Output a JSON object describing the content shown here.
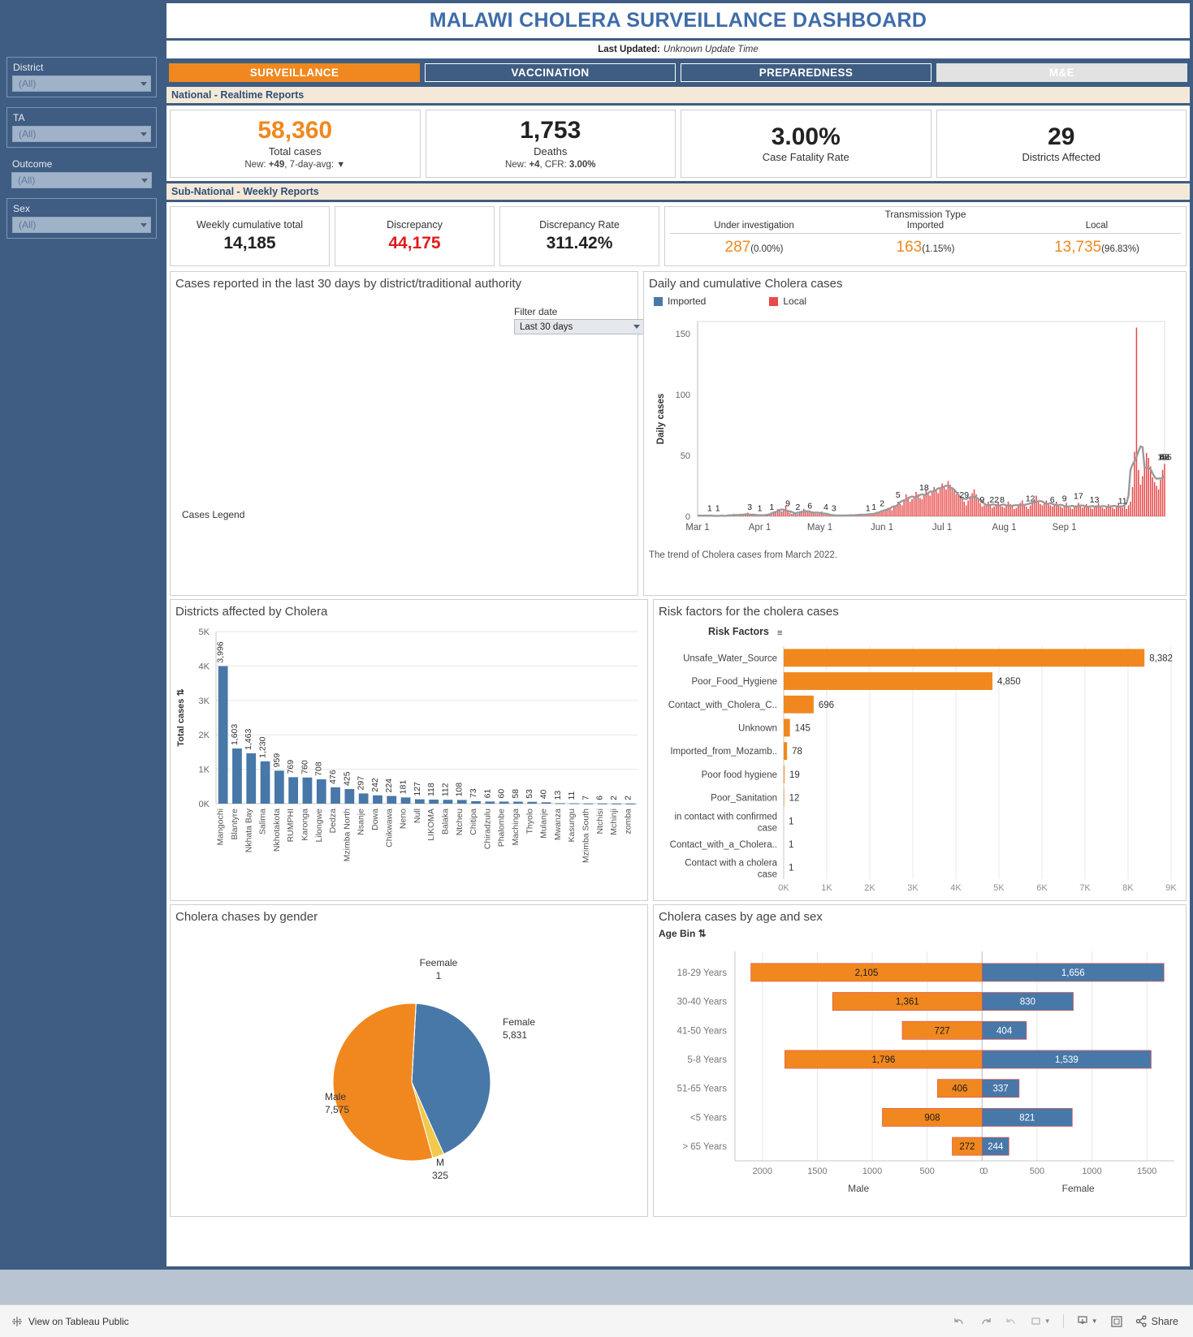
{
  "header": {
    "title": "MALAWI CHOLERA SURVEILLANCE DASHBOARD",
    "last_updated_label": "Last Updated:",
    "last_updated_value": "Unknown Update Time",
    "tabs": [
      {
        "label": "SURVEILLANCE",
        "state": "active"
      },
      {
        "label": "VACCINATION",
        "state": "normal"
      },
      {
        "label": "PREPAREDNESS",
        "state": "normal"
      },
      {
        "label": "M&E",
        "state": "inactive"
      }
    ]
  },
  "sidebar": {
    "filters": [
      {
        "label": "District",
        "value": "(All)"
      },
      {
        "label": "TA",
        "value": "(All)"
      },
      {
        "label": "Outcome",
        "value": "(All)"
      },
      {
        "label": "Sex",
        "value": "(All)"
      }
    ]
  },
  "national": {
    "section_label": "National - Realtime Reports",
    "kpis": [
      {
        "value": "58,360",
        "label": "Total cases",
        "sub_prefix": "New: ",
        "sub_new": "+49",
        "sub_mid": ", 7-day-avg: ",
        "trend": "▼",
        "color": "#f0881f"
      },
      {
        "value": "1,753",
        "label": "Deaths",
        "sub_prefix": "New: ",
        "sub_new": "+4",
        "sub_mid": ", CFR: ",
        "trend": "3.00%",
        "color": "#222222"
      },
      {
        "value": "3.00%",
        "label": "Case Fatality Rate",
        "color": "#222222"
      },
      {
        "value": "29",
        "label": "Districts Affected",
        "color": "#222222"
      }
    ]
  },
  "subnational": {
    "section_label": "Sub-National - Weekly Reports",
    "cards": [
      {
        "title": "Weekly cumulative total",
        "value": "14,185",
        "color": "#222222"
      },
      {
        "title": "Discrepancy",
        "value": "44,175",
        "color": "#e01b1b"
      },
      {
        "title": "Discrepancy Rate",
        "value": "311.42%",
        "color": "#222222"
      }
    ],
    "transmission": {
      "title": "Transmission Type",
      "columns": [
        "Under investigation",
        "Imported",
        "Local"
      ],
      "values": [
        "287",
        "163",
        "13,735"
      ],
      "percents": [
        "(0.00%)",
        "(1.15%)",
        "(96.83%)"
      ]
    }
  },
  "map_panel": {
    "title": "Cases reported in the last 30 days by district/traditional authority",
    "filter_label": "Filter date",
    "filter_value": "Last 30 days",
    "legend_label": "Cases Legend"
  },
  "timeseries_panel": {
    "title": "Daily and cumulative Cholera cases",
    "caption": "The trend of Cholera cases from March 2022."
  },
  "districts_panel": {
    "title": "Districts affected by Cholera"
  },
  "risk_panel": {
    "title": "Risk factors for the cholera cases",
    "field_label": "Risk Factors"
  },
  "gender_panel": {
    "title": "Cholera chases by gender"
  },
  "agesex_panel": {
    "title": "Cholera cases by age and sex",
    "field_label": "Age Bin"
  },
  "footer": {
    "view_label": "View on Tableau Public",
    "share_label": "Share",
    "icons": [
      "undo-icon",
      "redo-icon",
      "revert-icon",
      "refresh-icon",
      "pause-dropdown-icon",
      "download-icon",
      "fullscreen-icon",
      "share-icon"
    ]
  },
  "chart_data": [
    {
      "type": "bar",
      "name": "daily-cumulative-cholera-cases",
      "title": "Daily and cumulative Cholera cases",
      "xlabel": "",
      "ylabel": "Daily cases",
      "ylim": [
        0,
        160
      ],
      "yticks": [
        0,
        50,
        100,
        150
      ],
      "xticks": [
        "Mar 1",
        "Apr 1",
        "May 1",
        "Jun 1",
        "Jul 1",
        "Aug 1",
        "Sep 1"
      ],
      "legend": [
        {
          "name": "Imported",
          "color": "#4878a8"
        },
        {
          "name": "Local",
          "color": "#e8494a"
        }
      ],
      "legend_position": "top-left",
      "grid": false,
      "annotations": [
        {
          "label": "1",
          "x": 6
        },
        {
          "label": "1",
          "x": 10
        },
        {
          "label": "3",
          "x": 26
        },
        {
          "label": "1",
          "x": 31
        },
        {
          "label": "1",
          "x": 37
        },
        {
          "label": "9",
          "x": 45
        },
        {
          "label": "2",
          "x": 50
        },
        {
          "label": "6",
          "x": 56
        },
        {
          "label": "4",
          "x": 64
        },
        {
          "label": "3",
          "x": 68
        },
        {
          "label": "1",
          "x": 85
        },
        {
          "label": "1",
          "x": 88
        },
        {
          "label": "2",
          "x": 92
        },
        {
          "label": "5",
          "x": 100
        },
        {
          "label": "18",
          "x": 113
        },
        {
          "label": "29",
          "x": 133
        },
        {
          "label": "9",
          "x": 142
        },
        {
          "label": "22",
          "x": 148
        },
        {
          "label": "8",
          "x": 152
        },
        {
          "label": "12",
          "x": 166
        },
        {
          "label": "6",
          "x": 177
        },
        {
          "label": "9",
          "x": 183
        },
        {
          "label": "17",
          "x": 190
        },
        {
          "label": "13",
          "x": 198
        },
        {
          "label": "11",
          "x": 212
        },
        {
          "label": "155",
          "x": 233
        },
        {
          "label": "52",
          "x": 243
        },
        {
          "label": "48",
          "x": 245
        },
        {
          "label": "43",
          "x": 253
        }
      ],
      "series": [
        {
          "name": "Local",
          "color": "#e8494a",
          "peak": 155,
          "note": "daily local cases, March 2022 - Sep 2022"
        },
        {
          "name": "Imported",
          "color": "#4878a8",
          "peak": 9,
          "note": "daily imported cases"
        }
      ],
      "rolling_average_line": {
        "name": "7-day average",
        "color": "#999999"
      },
      "values": [
        0,
        1,
        0,
        1,
        1,
        0,
        1,
        0,
        0,
        1,
        1,
        0,
        0,
        0,
        1,
        1,
        0,
        1,
        2,
        1,
        0,
        1,
        2,
        1,
        1,
        3,
        2,
        1,
        1,
        1,
        1,
        1,
        1,
        0,
        1,
        1,
        1,
        2,
        3,
        4,
        6,
        5,
        4,
        6,
        9,
        5,
        3,
        2,
        2,
        2,
        2,
        3,
        4,
        6,
        5,
        4,
        3,
        4,
        3,
        2,
        2,
        3,
        4,
        3,
        2,
        1,
        1,
        1,
        1,
        0,
        1,
        1,
        0,
        1,
        1,
        0,
        1,
        1,
        1,
        1,
        1,
        1,
        1,
        2,
        2,
        1,
        1,
        2,
        2,
        2,
        3,
        3,
        5,
        4,
        6,
        7,
        6,
        5,
        8,
        9,
        12,
        10,
        9,
        14,
        18,
        16,
        12,
        14,
        16,
        20,
        18,
        15,
        14,
        18,
        22,
        19,
        17,
        20,
        24,
        22,
        19,
        23,
        27,
        25,
        22,
        29,
        26,
        24,
        21,
        18,
        20,
        16,
        14,
        12,
        9,
        13,
        16,
        19,
        22,
        18,
        14,
        11,
        8,
        9,
        10,
        12,
        9,
        7,
        8,
        10,
        12,
        9,
        8,
        7,
        9,
        12,
        10,
        8,
        6,
        7,
        9,
        11,
        13,
        10,
        8,
        6,
        9,
        11,
        14,
        17,
        13,
        10,
        9,
        12,
        13,
        11,
        9,
        8,
        10,
        12,
        9,
        8,
        7,
        9,
        11,
        8,
        7,
        6,
        8,
        9,
        11,
        8,
        7,
        9,
        10,
        8,
        7,
        6,
        8,
        9,
        11,
        8,
        7,
        6,
        8,
        10,
        9,
        7,
        6,
        8,
        11,
        9,
        7,
        8,
        6,
        9,
        12,
        24,
        53,
        155,
        38,
        26,
        33,
        45,
        52,
        48,
        41,
        32,
        28,
        25,
        22,
        30,
        38,
        43
      ]
    },
    {
      "type": "bar",
      "name": "districts-affected-by-cholera",
      "title": "Districts affected by Cholera",
      "xlabel": "",
      "ylabel": "Total cases",
      "ylim": [
        0,
        5000
      ],
      "yticks": [
        "0K",
        "1K",
        "2K",
        "3K",
        "4K",
        "5K"
      ],
      "bar_color": "#4878a8",
      "categories": [
        "Mangochi",
        "Blantyre",
        "Nkhata Bay",
        "Salima",
        "Nkhotakota",
        "RUMPHI",
        "Karonga",
        "Lilongwe",
        "Dedza",
        "Mzimba North",
        "Nsanje",
        "Dowa",
        "Chikwawa",
        "Neno",
        "Null",
        "LIKOMA",
        "Balaka",
        "Ntcheu",
        "Chitipa",
        "Chiradzulu",
        "Phalombe",
        "Machinga",
        "Thyolo",
        "Mulanje",
        "Mwanza",
        "Kasungu",
        "Mzimba South",
        "Ntchisi",
        "Mchinji",
        "zomba"
      ],
      "values": [
        3996,
        1603,
        1463,
        1230,
        959,
        769,
        760,
        708,
        476,
        425,
        297,
        242,
        224,
        181,
        127,
        118,
        112,
        108,
        73,
        61,
        60,
        58,
        53,
        40,
        13,
        11,
        7,
        6,
        2,
        2
      ],
      "value_labels": [
        "3,996",
        "1,603",
        "1,463",
        "1,230",
        "959",
        "769",
        "760",
        "708",
        "476",
        "425",
        "297",
        "242",
        "224",
        "181",
        "127",
        "118",
        "112",
        "108",
        "73",
        "61",
        "60",
        "58",
        "53",
        "40",
        "13",
        "11",
        "7",
        "6",
        "2",
        "2"
      ]
    },
    {
      "type": "bar",
      "name": "risk-factors-for-cholera-cases",
      "title": "Risk factors for the cholera cases",
      "orientation": "horizontal",
      "xlabel": "",
      "ylabel": "Risk Factors",
      "bar_color": "#f0881f",
      "xlim": [
        0,
        9000
      ],
      "xticks": [
        "0K",
        "1K",
        "2K",
        "3K",
        "4K",
        "5K",
        "6K",
        "7K",
        "8K",
        "9K"
      ],
      "categories": [
        "Unsafe_Water_Source",
        "Poor_Food_Hygiene",
        "Contact_with_Cholera_C..",
        "Unknown",
        "Imported_from_Mozamb..",
        "Poor food hygiene",
        "Poor_Sanitation",
        "in contact with confirmed case",
        "Contact_with_a_Cholera..",
        "Contact with a cholera case"
      ],
      "values": [
        8382,
        4850,
        696,
        145,
        78,
        19,
        12,
        1,
        1,
        1
      ],
      "value_labels": [
        "8,382",
        "4,850",
        "696",
        "145",
        "78",
        "19",
        "12",
        "1",
        "1",
        "1"
      ]
    },
    {
      "type": "pie",
      "name": "cholera-cases-by-gender",
      "title": "Cholera chases by gender",
      "labels": [
        "Female",
        "Male",
        "M",
        "Feemale"
      ],
      "values": [
        5831,
        7575,
        325,
        1
      ],
      "value_labels": [
        "5,831",
        "7,575",
        "325",
        "1"
      ],
      "colors": [
        "#4878a8",
        "#f0881f",
        "#f2c94c",
        "#55a630"
      ]
    },
    {
      "type": "bar",
      "name": "cholera-cases-by-age-and-sex",
      "title": "Cholera cases by age and sex",
      "orientation": "butterfly",
      "ylabel": "Age Bin",
      "categories": [
        "18-29 Years",
        "30-40 Years",
        "41-50 Years",
        "5-8 Years",
        "51-65 Years",
        "<5 Years",
        "> 65 Years"
      ],
      "series": [
        {
          "name": "Male",
          "color": "#f0881f",
          "values": [
            2105,
            1361,
            727,
            1796,
            406,
            908,
            272
          ],
          "value_labels": [
            "2,105",
            "1,361",
            "727",
            "1,796",
            "406",
            "908",
            "272"
          ]
        },
        {
          "name": "Female",
          "color": "#4878a8",
          "values": [
            1656,
            830,
            404,
            1539,
            337,
            821,
            244
          ],
          "value_labels": [
            "1,656",
            "830",
            "404",
            "1,539",
            "337",
            "821",
            "244"
          ]
        }
      ],
      "left_axis_ticks": [
        "2000",
        "1500",
        "1000",
        "500",
        "0"
      ],
      "right_axis_ticks": [
        "0",
        "500",
        "1000",
        "1500"
      ],
      "axis_group_labels": [
        "Male",
        "Female"
      ]
    }
  ]
}
